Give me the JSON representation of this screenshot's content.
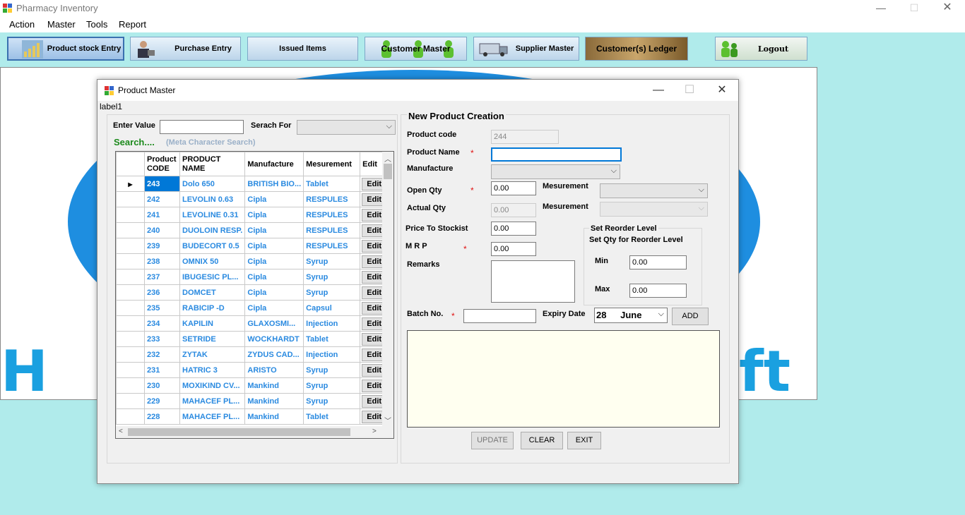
{
  "app": {
    "title": "Pharmacy Inventory",
    "minimize": "—",
    "maximize": "☐",
    "close": "✕"
  },
  "menu": [
    "Action",
    "Master",
    "Tools",
    "Report"
  ],
  "toolbar": [
    {
      "label": "Product stock Entry",
      "icon": "chart-icon"
    },
    {
      "label": "Purchase Entry",
      "icon": "businessman-icon"
    },
    {
      "label": "Issued Items",
      "icon": "none"
    },
    {
      "label": "Customer Master",
      "icon": "people-icon"
    },
    {
      "label": "Supplier Master",
      "icon": "truck-icon"
    },
    {
      "label": "Customer(s) Ledger",
      "icon": "ledger-icon"
    },
    {
      "label": "Logout",
      "icon": "people-icon"
    }
  ],
  "background": {
    "left_text": "H",
    "right_text": "ft"
  },
  "dialog": {
    "title": "Product Master",
    "minimize": "—",
    "maximize": "☐",
    "close": "✕",
    "label1": "label1",
    "search": {
      "enter_value_label": "Enter Value",
      "enter_value": "",
      "search_for_label": "Serach For",
      "search_for_value": "",
      "search_caption": "Search....",
      "meta_caption": "(Meta Character Search)"
    },
    "grid": {
      "columns": [
        "Product CODE",
        "PRODUCT NAME",
        "Manufacture",
        "Mesurement",
        "Edit"
      ],
      "rows": [
        {
          "code": "243",
          "name": "Dolo 650",
          "mfr": "BRITISH BIO...",
          "mes": "Tablet",
          "edit": "Edit"
        },
        {
          "code": "242",
          "name": "LEVOLIN 0.63",
          "mfr": "Cipla",
          "mes": "RESPULES",
          "edit": "Edit"
        },
        {
          "code": "241",
          "name": "LEVOLINE 0.31",
          "mfr": "Cipla",
          "mes": "RESPULES",
          "edit": "Edit"
        },
        {
          "code": "240",
          "name": "DUOLOIN RESP.",
          "mfr": "Cipla",
          "mes": "RESPULES",
          "edit": "Edit"
        },
        {
          "code": "239",
          "name": "BUDECORT 0.5",
          "mfr": "Cipla",
          "mes": "RESPULES",
          "edit": "Edit"
        },
        {
          "code": "238",
          "name": "OMNIX  50",
          "mfr": "Cipla",
          "mes": "Syrup",
          "edit": "Edit"
        },
        {
          "code": "237",
          "name": "IBUGESIC  PL...",
          "mfr": "Cipla",
          "mes": "Syrup",
          "edit": "Edit"
        },
        {
          "code": "236",
          "name": "DOMCET",
          "mfr": "Cipla",
          "mes": "Syrup",
          "edit": "Edit"
        },
        {
          "code": "235",
          "name": "RABICIP -D",
          "mfr": "Cipla",
          "mes": "Capsul",
          "edit": "Edit"
        },
        {
          "code": "234",
          "name": "KAPILIN",
          "mfr": "GLAXOSMI...",
          "mes": "Injection",
          "edit": "Edit"
        },
        {
          "code": "233",
          "name": "SETRIDE",
          "mfr": "WOCKHARDT",
          "mes": "Tablet",
          "edit": "Edit"
        },
        {
          "code": "232",
          "name": "ZYTAK",
          "mfr": "ZYDUS CAD...",
          "mes": "Injection",
          "edit": "Edit"
        },
        {
          "code": "231",
          "name": "HATRIC 3",
          "mfr": "ARISTO",
          "mes": "Syrup",
          "edit": "Edit"
        },
        {
          "code": "230",
          "name": "MOXIKIND CV...",
          "mfr": "Mankind",
          "mes": "Syrup",
          "edit": "Edit"
        },
        {
          "code": "229",
          "name": "MAHACEF PL...",
          "mfr": "Mankind",
          "mes": "Syrup",
          "edit": "Edit"
        },
        {
          "code": "228",
          "name": "MAHACEF PL...",
          "mfr": "Mankind",
          "mes": "Tablet",
          "edit": "Edit"
        }
      ]
    },
    "form": {
      "group_title": "New Product Creation",
      "product_code_label": "Product code",
      "product_code": "244",
      "product_name_label": "Product Name",
      "product_name": "",
      "manufacture_label": "Manufacture",
      "open_qty_label": "Open Qty",
      "open_qty": "0.00",
      "mesurement_label": "Mesurement",
      "actual_qty_label": "Actual Qty",
      "actual_qty": "0.00",
      "mesurement2_label": "Mesurement",
      "price_label": "Price To Stockist",
      "price": "0.00",
      "mrp_label": "M R P",
      "mrp": "0.00",
      "remarks_label": "Remarks",
      "reorder_title": "Set Reorder Level",
      "reorder_sub": "Set Qty for Reorder Level",
      "min_label": "Min",
      "min": "0.00",
      "max_label": "Max",
      "max": "0.00",
      "batch_label": "Batch No.",
      "batch": "",
      "expiry_label": "Expiry Date",
      "expiry_day": "28",
      "expiry_month": "June",
      "required": "*",
      "add": "ADD",
      "update": "UPDATE",
      "clear": "CLEAR",
      "exit": "EXIT"
    }
  }
}
